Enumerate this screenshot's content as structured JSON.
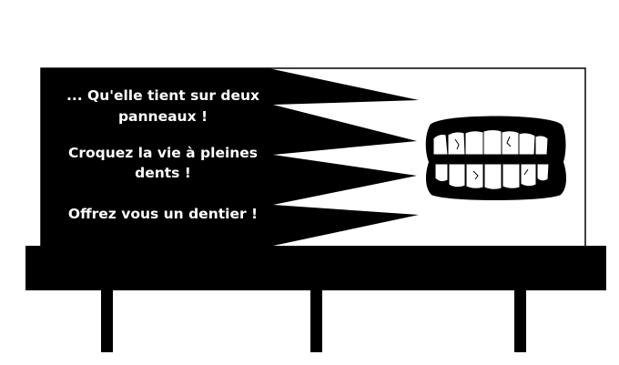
{
  "billboard": {
    "lines": [
      "... Qu'elle tient sur deux",
      "panneaux !",
      "Croquez la vie à pleines",
      "dents !",
      "Offrez vous un dentier !"
    ]
  },
  "illustration": {
    "icon": "dentures-icon"
  },
  "colors": {
    "ink": "#000000",
    "paper": "#ffffff"
  }
}
